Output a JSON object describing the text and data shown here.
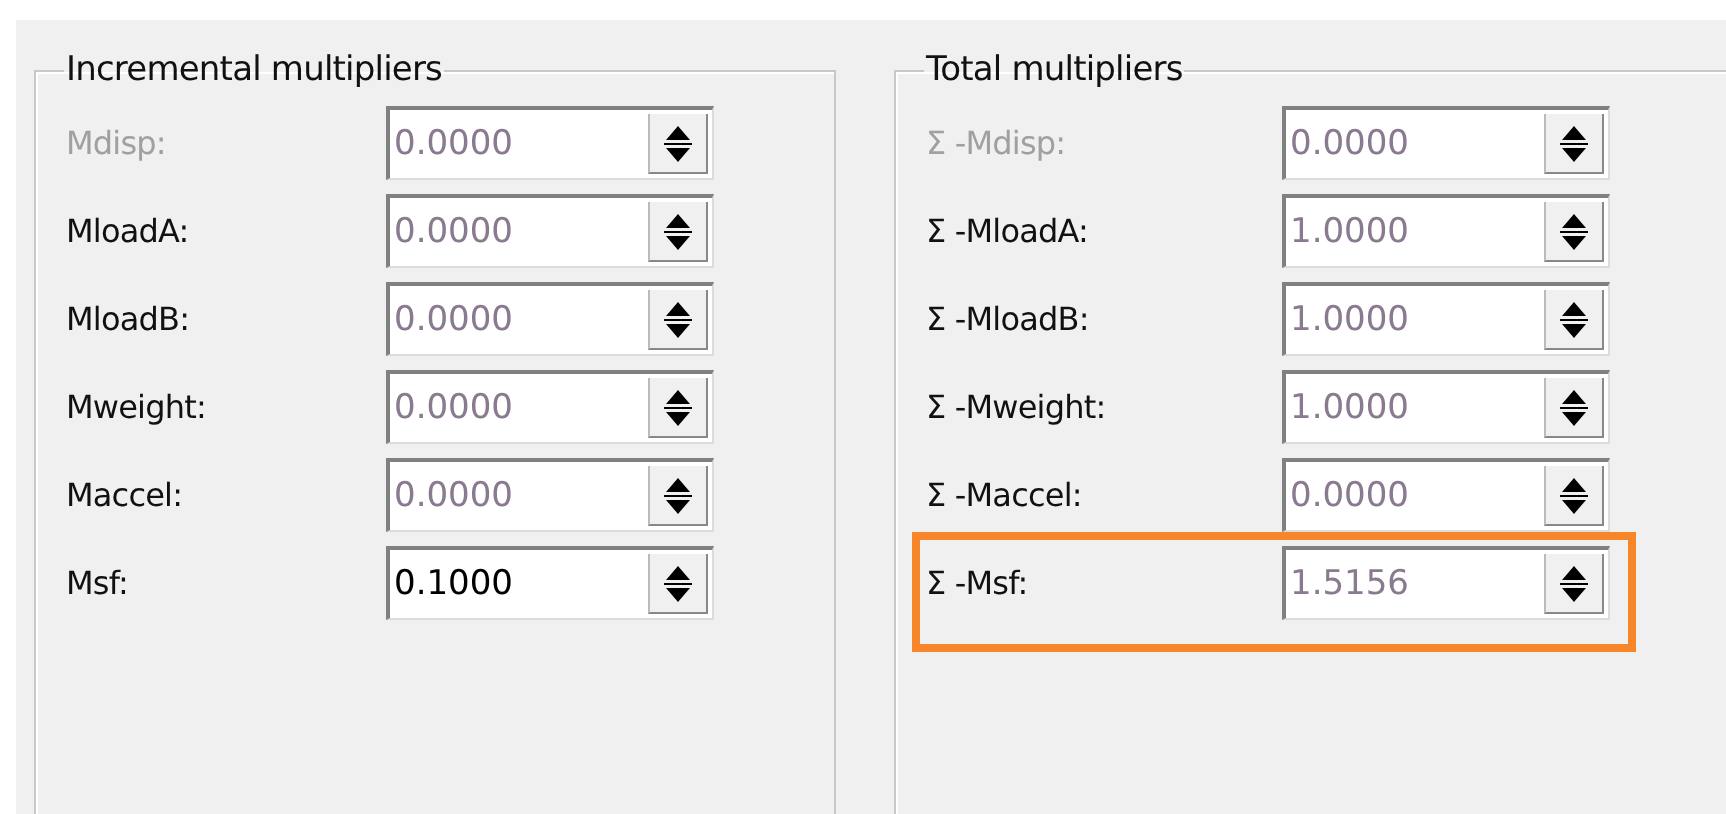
{
  "groups": [
    {
      "title": "Incremental multipliers",
      "rows": [
        {
          "label": "Mdisp:",
          "value": "0.0000",
          "disabled": true,
          "editable": false,
          "highlighted": false
        },
        {
          "label": "MloadA:",
          "value": "0.0000",
          "disabled": false,
          "editable": false,
          "highlighted": false
        },
        {
          "label": "MloadB:",
          "value": "0.0000",
          "disabled": false,
          "editable": false,
          "highlighted": false
        },
        {
          "label": "Mweight:",
          "value": "0.0000",
          "disabled": false,
          "editable": false,
          "highlighted": false
        },
        {
          "label": "Maccel:",
          "value": "0.0000",
          "disabled": false,
          "editable": false,
          "highlighted": false
        },
        {
          "label": "Msf:",
          "value": "0.1000",
          "disabled": false,
          "editable": true,
          "highlighted": false
        }
      ]
    },
    {
      "title": "Total multipliers",
      "rows": [
        {
          "label": "Σ -Mdisp:",
          "value": "0.0000",
          "disabled": true,
          "editable": false,
          "highlighted": false
        },
        {
          "label": "Σ -MloadA:",
          "value": "1.0000",
          "disabled": false,
          "editable": false,
          "highlighted": false
        },
        {
          "label": "Σ -MloadB:",
          "value": "1.0000",
          "disabled": false,
          "editable": false,
          "highlighted": false
        },
        {
          "label": "Σ -Mweight:",
          "value": "1.0000",
          "disabled": false,
          "editable": false,
          "highlighted": false
        },
        {
          "label": "Σ -Maccel:",
          "value": "0.0000",
          "disabled": false,
          "editable": false,
          "highlighted": false
        },
        {
          "label": "Σ -Msf:",
          "value": "1.5156",
          "disabled": false,
          "editable": false,
          "highlighted": true
        }
      ]
    }
  ]
}
